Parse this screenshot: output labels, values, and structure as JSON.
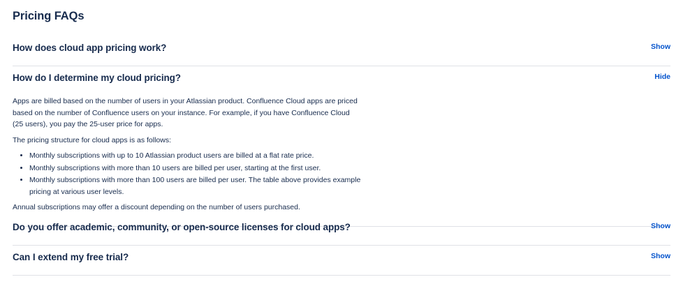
{
  "title": "Pricing FAQs",
  "faqs": [
    {
      "question": "How does cloud app pricing work?",
      "toggle": "Show"
    },
    {
      "question": "How do I determine my cloud pricing?",
      "toggle": "Hide",
      "answer": {
        "paragraph_1": "Apps are billed based on the number of users in your Atlassian product. Confluence Cloud apps are priced based on the number of Confluence users on your instance. For example, if you have Confluence Cloud (25 users), you pay the 25-user price for apps.",
        "paragraph_2": "The pricing structure for cloud apps is as follows:",
        "bullets": [
          "Monthly subscriptions with up to 10 Atlassian product users are billed at a flat rate price.",
          "Monthly subscriptions with more than 10 users are billed per user, starting at the first user.",
          "Monthly subscriptions with more than 100 users are billed per user. The table above provides example pricing at various user levels."
        ],
        "paragraph_3": "Annual subscriptions may offer a discount depending on the number of users purchased."
      }
    },
    {
      "question": "Do you offer academic, community, or open-source licenses for cloud apps?",
      "toggle": "Show"
    },
    {
      "question": "Can I extend my free trial?",
      "toggle": "Show"
    }
  ],
  "colors": {
    "text": "#172b4d",
    "link": "#0052cc",
    "divider": "#dfe1e6"
  }
}
